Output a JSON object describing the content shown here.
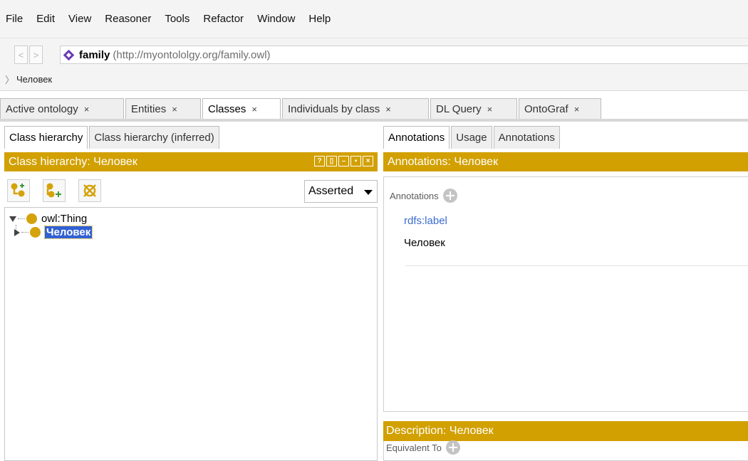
{
  "menu": [
    "File",
    "Edit",
    "View",
    "Reasoner",
    "Tools",
    "Refactor",
    "Window",
    "Help"
  ],
  "nav": {
    "back": "<",
    "forward": ">"
  },
  "ontology": {
    "name": "family",
    "iri": "(http://myontololgy.org/family.owl)"
  },
  "breadcrumb": "Человек",
  "tabs": [
    {
      "label": "Active ontology",
      "close": "×",
      "active": false
    },
    {
      "label": "Entities",
      "close": "×",
      "active": false
    },
    {
      "label": "Classes",
      "close": "×",
      "active": true
    },
    {
      "label": "Individuals by class",
      "close": "×",
      "active": false
    },
    {
      "label": "DL Query",
      "close": "×",
      "active": false
    },
    {
      "label": "OntoGraf",
      "close": "×",
      "active": false
    }
  ],
  "left": {
    "subtabs": [
      "Class hierarchy",
      "Class hierarchy (inferred)"
    ],
    "title": "Class hierarchy: Человек",
    "window_buttons": [
      "?",
      "▯",
      "–",
      "▪",
      "×"
    ],
    "dropdown": "Asserted",
    "tree": [
      {
        "label": "owl:Thing",
        "expanded": true,
        "selected": false
      },
      {
        "label": "Человек",
        "expanded": false,
        "selected": true
      }
    ]
  },
  "right": {
    "subtabs": [
      "Annotations",
      "Usage",
      "Annotations"
    ],
    "title": "Annotations: Человек",
    "annotations_header": "Annotations",
    "annotation": {
      "property": "rdfs:label",
      "value": "Человек"
    },
    "description_title": "Description: Человек",
    "equivalent_header": "Equivalent To"
  },
  "colors": {
    "accent": "#d2a000",
    "class_dot": "#d4a20a",
    "selection": "#3261d3",
    "link": "#3a6ccf",
    "ontology_icon": "#6b3bb5"
  }
}
